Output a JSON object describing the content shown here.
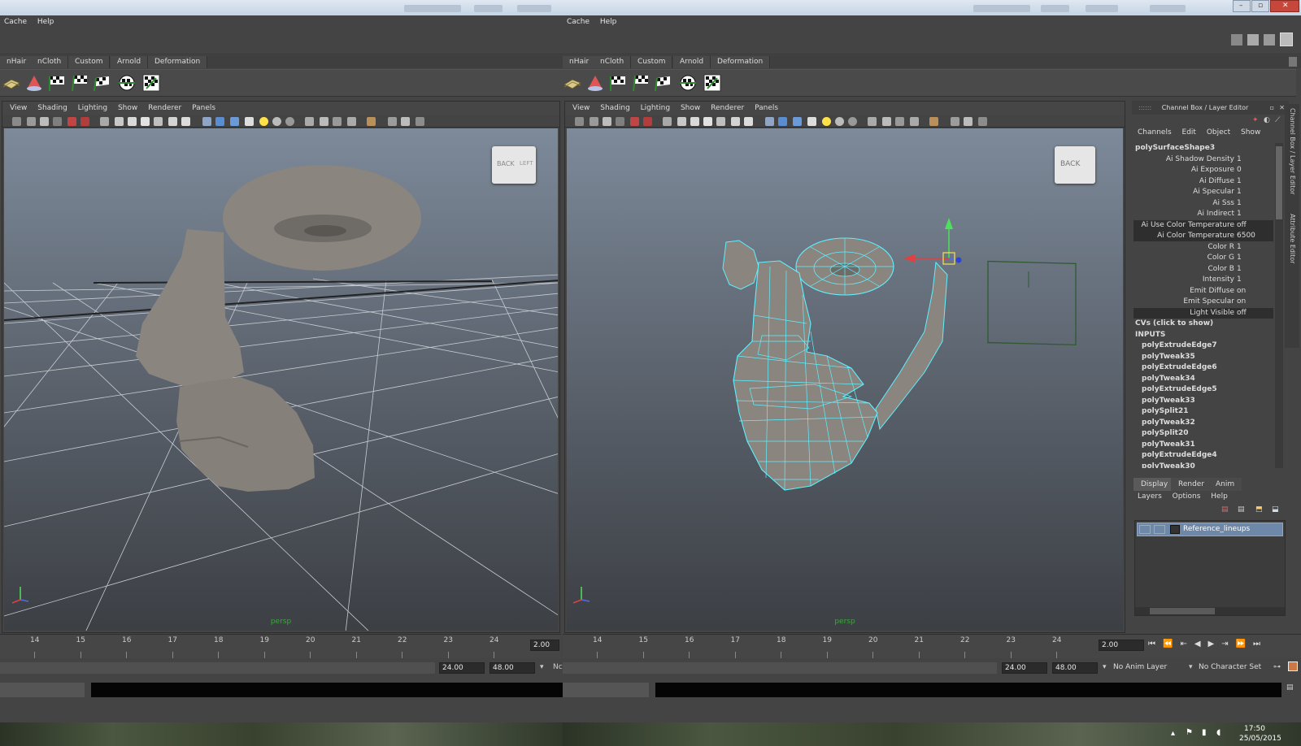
{
  "left": {
    "menu": [
      "Cache",
      "Help"
    ],
    "shelf_tabs": [
      "nHair",
      "nCloth",
      "Custom",
      "Arnold",
      "Deformation"
    ],
    "viewport_menu": [
      "View",
      "Shading",
      "Lighting",
      "Show",
      "Renderer",
      "Panels"
    ],
    "viewcube_labels": [
      "BACK",
      "LEFT"
    ],
    "camera": "persp",
    "timeline_ticks": [
      "14",
      "15",
      "16",
      "17",
      "18",
      "19",
      "20",
      "21",
      "22",
      "23",
      "24"
    ],
    "current_frame": "2.00",
    "range_end": "24.00",
    "range_max": "48.00",
    "cut_label": "Nc"
  },
  "right": {
    "menu": [
      "Cache",
      "Help"
    ],
    "shelf_tabs": [
      "nHair",
      "nCloth",
      "Custom",
      "Arnold",
      "Deformation"
    ],
    "viewport_menu": [
      "View",
      "Shading",
      "Lighting",
      "Show",
      "Renderer",
      "Panels"
    ],
    "viewcube_label": "BACK",
    "camera": "persp",
    "timeline_ticks": [
      "14",
      "15",
      "16",
      "17",
      "18",
      "19",
      "20",
      "21",
      "22",
      "23",
      "24"
    ],
    "current_frame": "2.00",
    "range_end": "24.00",
    "range_max": "48.00",
    "anim_layer": "No Anim Layer",
    "character_set": "No Character Set"
  },
  "channel_box": {
    "title": "Channel Box / Layer Editor",
    "menu": [
      "Channels",
      "Edit",
      "Object",
      "Show"
    ],
    "object_name": "polySurfaceShape3",
    "attributes": [
      {
        "label": "Ai Shadow Density",
        "value": "1",
        "hl": false
      },
      {
        "label": "Ai Exposure",
        "value": "0",
        "hl": false
      },
      {
        "label": "Ai Diffuse",
        "value": "1",
        "hl": false
      },
      {
        "label": "Ai Specular",
        "value": "1",
        "hl": false
      },
      {
        "label": "Ai Sss",
        "value": "1",
        "hl": false
      },
      {
        "label": "Ai Indirect",
        "value": "1",
        "hl": false
      },
      {
        "label": "Ai Use Color Temperature",
        "value": "off",
        "hl": true
      },
      {
        "label": "Ai Color Temperature",
        "value": "6500",
        "hl": true
      },
      {
        "label": "Color R",
        "value": "1",
        "hl": false
      },
      {
        "label": "Color G",
        "value": "1",
        "hl": false
      },
      {
        "label": "Color B",
        "value": "1",
        "hl": false
      },
      {
        "label": "Intensity",
        "value": "1",
        "hl": false
      },
      {
        "label": "Emit Diffuse",
        "value": "on",
        "hl": false
      },
      {
        "label": "Emit Specular",
        "value": "on",
        "hl": false
      },
      {
        "label": "Light Visible",
        "value": "off",
        "hl": true
      }
    ],
    "cvs_label": "CVs (click to show)",
    "inputs_label": "INPUTS",
    "inputs": [
      "polyExtrudeEdge7",
      "polyTweak35",
      "polyExtrudeEdge6",
      "polyTweak34",
      "polyExtrudeEdge5",
      "polyTweak33",
      "polySplit21",
      "polyTweak32",
      "polySplit20",
      "polyTweak31",
      "polyExtrudeEdge4",
      "polyTweak30"
    ],
    "tabs": [
      "Display",
      "Render",
      "Anim"
    ],
    "layer_menu": [
      "Layers",
      "Options",
      "Help"
    ],
    "layer_name": "Reference_lineups",
    "side_tabs": [
      "Channel Box / Layer Editor",
      "Attribute Editor"
    ]
  },
  "taskbar": {
    "time": "17:50",
    "date": "25/05/2015"
  },
  "colors": {
    "wire": "#5ff0ff",
    "grid": "#c8ccd2",
    "mesh": "#8a857f",
    "layer_highlight": "#6d88a8",
    "camera_label": "#3fa43f"
  }
}
